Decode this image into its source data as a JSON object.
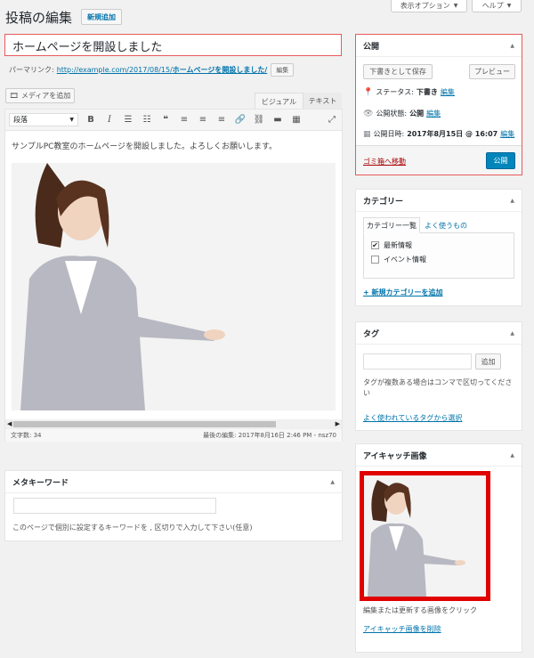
{
  "header": {
    "title": "投稿の編集",
    "new_button": "新規追加",
    "screen_options": "表示オプション",
    "help": "ヘルプ"
  },
  "post": {
    "title": "ホームページを開設しました",
    "permalink_label": "パーマリンク:",
    "permalink_base": "http://example.com/2017/08/15/",
    "permalink_slug": "ホームページを開設しました/",
    "permalink_edit": "編集"
  },
  "editor": {
    "add_media": "メディアを追加",
    "tab_visual": "ビジュアル",
    "tab_text": "テキスト",
    "format_select": "段落",
    "content_text": "サンプルPC教室のホームページを開設しました。よろしくお願いします。",
    "word_count": "文字数: 34",
    "last_edit": "最後の編集: 2017年8月16日 2:46 PM - nsz70"
  },
  "meta_keywords": {
    "title": "メタキーワード",
    "input_value": "",
    "help_text": "このページで個別に設定するキーワードを , 区切りで入力して下さい(任意)"
  },
  "publish": {
    "title": "公開",
    "save_draft": "下書きとして保存",
    "preview": "プレビュー",
    "status_label": "ステータス:",
    "status_value": "下書き",
    "status_edit": "編集",
    "visibility_label": "公開状態:",
    "visibility_value": "公開",
    "visibility_edit": "編集",
    "date_label": "公開日時:",
    "date_value": "2017年8月15日 @ 16:07",
    "date_edit": "編集",
    "trash": "ゴミ箱へ移動",
    "publish_button": "公開"
  },
  "categories": {
    "title": "カテゴリー",
    "tab_all": "カテゴリー一覧",
    "tab_popular": "よく使うもの",
    "items": [
      {
        "label": "最新情報",
        "checked": true
      },
      {
        "label": "イベント情報",
        "checked": false
      }
    ],
    "add_new": "+ 新規カテゴリーを追加"
  },
  "tags": {
    "title": "タグ",
    "input_value": "",
    "add_button": "追加",
    "help_text": "タグが複数ある場合はコンマで区切ってください",
    "choose_link": "よく使われているタグから選択"
  },
  "featured": {
    "title": "アイキャッチ画像",
    "help_text": "編集または更新する画像をクリック",
    "remove_link": "アイキャッチ画像を削除"
  },
  "colors": {
    "accent": "#0073aa",
    "highlight_border": "#e85a5a",
    "featured_border": "#e00000",
    "trash": "#a00"
  }
}
